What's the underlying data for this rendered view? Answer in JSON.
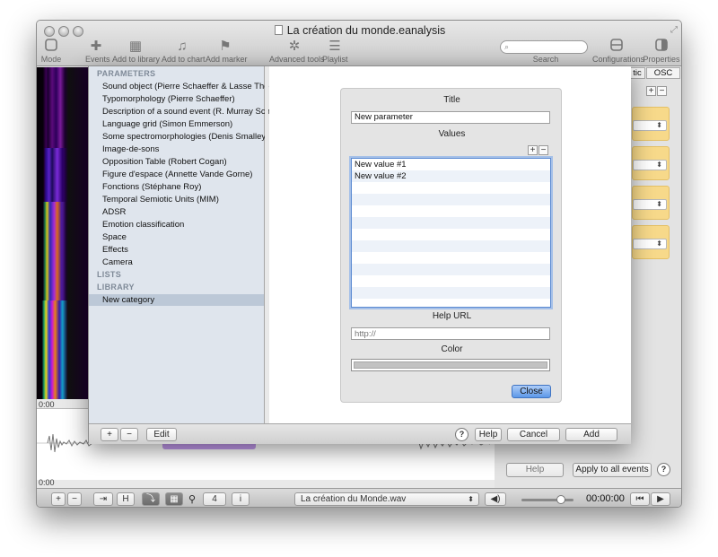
{
  "window": {
    "title": "La création du monde.eanalysis"
  },
  "toolbar": {
    "items": [
      {
        "label": "Mode",
        "icon": "mode-icon"
      },
      {
        "label": "Events",
        "icon": "plus-icon"
      },
      {
        "label": "Add to library",
        "icon": "library-icon"
      },
      {
        "label": "Add to chart",
        "icon": "chart-icon"
      },
      {
        "label": "Add marker",
        "icon": "marker-icon"
      },
      {
        "label": "Advanced tools",
        "icon": "gear-icon"
      },
      {
        "label": "Playlist",
        "icon": "list-icon"
      },
      {
        "label": "Configurations",
        "icon": "configurations-icon"
      },
      {
        "label": "Properties",
        "icon": "properties-icon"
      }
    ],
    "search_label": "Search",
    "search_placeholder": ""
  },
  "timeline": {
    "start_time_top": "0:00",
    "start_time_bottom": "0:00"
  },
  "right_panel": {
    "tabs": [
      "tic",
      "OSC"
    ],
    "add": "+",
    "remove": "−",
    "help_label": "Help",
    "apply_label": "Apply to all events",
    "question": "?",
    "accent_color": "#f7d98a"
  },
  "sidebar": {
    "sections": {
      "parameters": "PARAMETERS",
      "lists": "LISTS",
      "library": "LIBRARY"
    },
    "parameters": [
      "Sound object (Pierre Schaeffer & Lasse Thoresen)",
      "Typomorphology (Pierre Schaeffer)",
      "Description of a sound event (R. Murray Schafer)",
      "Language grid (Simon Emmerson)",
      "Some spectromorphologies (Denis Smalley)",
      "Image-de-sons",
      "Opposition Table (Robert Cogan)",
      "Figure d'espace (Annette Vande Gorne)",
      "Fonctions (Stéphane Roy)",
      "Temporal Semiotic Units (MIM)",
      "ADSR",
      "Emotion classification",
      "Space",
      "Effects",
      "Camera"
    ],
    "library": [
      "New category"
    ],
    "selected_color": "#bcc8d7"
  },
  "editor": {
    "title_label": "Title",
    "title_value": "New parameter",
    "values_label": "Values",
    "values": [
      "New value #1",
      "New value #2"
    ],
    "add": "+",
    "remove": "−",
    "help_url_label": "Help URL",
    "help_url_placeholder": "http://",
    "color_label": "Color",
    "close_label": "Close"
  },
  "sheet_bar": {
    "add": "+",
    "remove": "−",
    "edit_label": "Edit",
    "question": "?",
    "help_label": "Help",
    "cancel_label": "Cancel",
    "add_label": "Add"
  },
  "bottom_bar": {
    "add": "+",
    "remove": "−",
    "zoom_value": "4",
    "info": "i",
    "file_name": "La création du Monde.wav",
    "time": "00:00:00",
    "volume_fraction": 0.75
  }
}
